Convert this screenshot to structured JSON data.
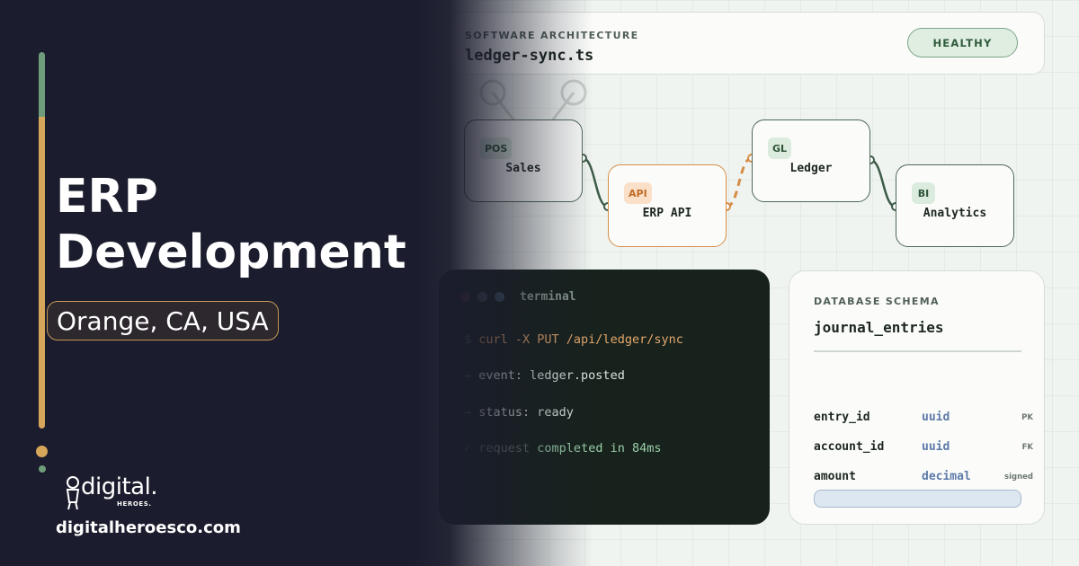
{
  "hero": {
    "title_line1": "ERP",
    "title_line2": "Development",
    "location": "Orange, CA, USA"
  },
  "brand": {
    "wordmark": "digital.",
    "sub": "HEROES.",
    "url": "digitalheroesco.com"
  },
  "header": {
    "kicker": "SOFTWARE ARCHITECTURE",
    "file": "ledger-sync.ts",
    "status": "HEALTHY"
  },
  "diagram": {
    "nodes": [
      {
        "tag": "POS",
        "label": "Sales"
      },
      {
        "tag": "API",
        "label": "ERP API"
      },
      {
        "tag": "GL",
        "label": "Ledger"
      },
      {
        "tag": "BI",
        "label": "Analytics"
      }
    ]
  },
  "terminal": {
    "title": "terminal",
    "lines": [
      {
        "prefix": "$ ",
        "text": "curl -X PUT /api/ledger/sync"
      },
      {
        "prefix": "→ ",
        "text": "event: ledger.posted"
      },
      {
        "prefix": "→ ",
        "text": "status: ready"
      },
      {
        "prefix": "✓ ",
        "text": "request ",
        "ok": "completed in 84ms"
      }
    ]
  },
  "schema": {
    "kicker": "DATABASE SCHEMA",
    "table": "journal_entries",
    "fields": [
      {
        "name": "entry_id",
        "type": "uuid",
        "tag": "PK"
      },
      {
        "name": "account_id",
        "type": "uuid",
        "tag": "FK"
      },
      {
        "name": "amount",
        "type": "decimal",
        "tag": "signed"
      }
    ]
  },
  "colors": {
    "left_bg": "#1b1c2d",
    "accent_gold": "#d6a65a",
    "accent_green": "#6f9c7a",
    "terminal_bg": "#17221d",
    "api_orange": "#d58e48"
  }
}
